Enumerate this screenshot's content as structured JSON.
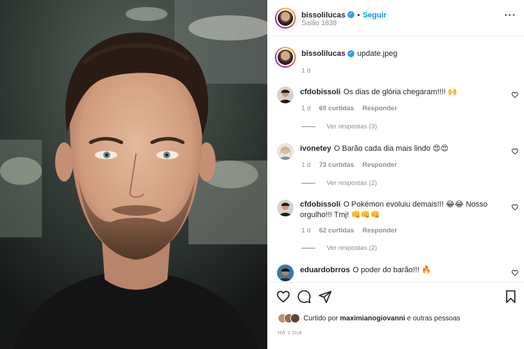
{
  "post": {
    "author": "bissolilucas",
    "follow_label": "Seguir",
    "location": "Salão 1838",
    "more_label": "···",
    "caption_author": "bissolilucas",
    "caption_text": "update.jpeg",
    "caption_time": "1 d",
    "photo_alt": "Man with short dark hair and beard"
  },
  "comments": [
    {
      "user": "cfdobissoli",
      "text": "Os dias de glória chegaram!!!! 🙌",
      "time": "1 d",
      "likes": "69 curtidas",
      "reply": "Responder",
      "view_replies": "Ver respostas (3)"
    },
    {
      "user": "ivonetey",
      "text": "O Barão cada dia mais lindo 😍😍",
      "time": "1 d",
      "likes": "73 curtidas",
      "reply": "Responder",
      "view_replies": "Ver respostas (2)"
    },
    {
      "user": "cfdobissoli",
      "text": "O Pokémon evoluiu demais!!! 😂😂 Nosso orgulho!!! Tmj! 👊👊👊",
      "time": "1 d",
      "likes": "62 curtidas",
      "reply": "Responder",
      "view_replies": "Ver respostas (2)"
    },
    {
      "user": "eduardobrros",
      "text": "O poder do barão!!! 🔥"
    }
  ],
  "footer": {
    "liked_by_prefix": "Curtido por",
    "liked_by_user": "maximianogiovanni",
    "liked_by_suffix": "e outras pessoas",
    "time_ago": "HÁ 1 DIA"
  },
  "colors": {
    "accent": "#0095f6",
    "verified": "#3897f0",
    "muted": "#8e8e8e",
    "text": "#262626"
  },
  "icons": [
    "heart-icon",
    "comment-icon",
    "share-icon",
    "bookmark-icon",
    "verified-badge-icon",
    "more-options-icon"
  ]
}
